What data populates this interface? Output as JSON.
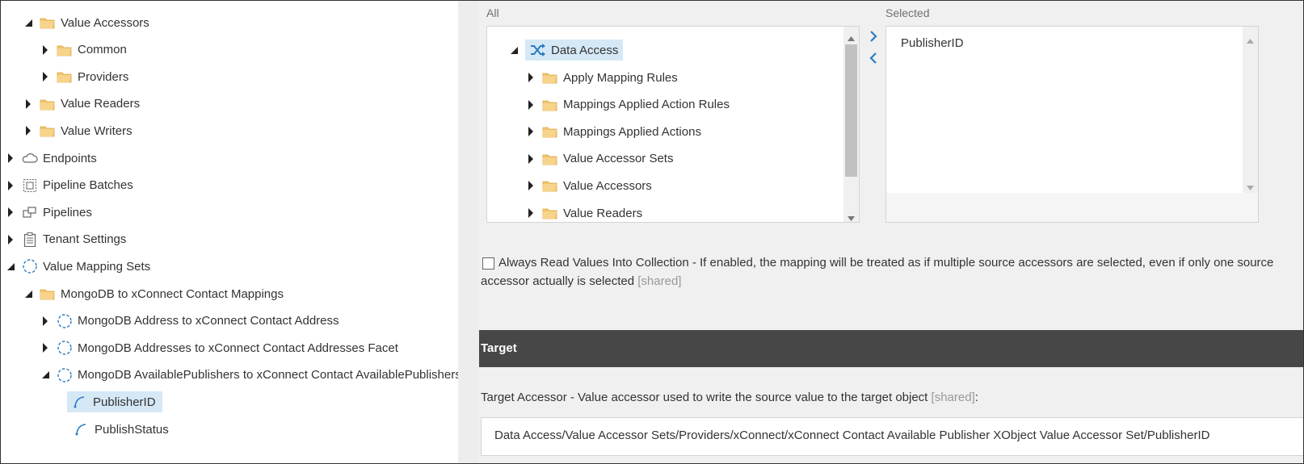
{
  "tree": [
    {
      "label": "Value Accessors",
      "level": 1,
      "expander": "down",
      "icon": "folder-icon"
    },
    {
      "label": "Common",
      "level": 2,
      "expander": "right",
      "icon": "folder-icon"
    },
    {
      "label": "Providers",
      "level": 2,
      "expander": "right",
      "icon": "folder-icon"
    },
    {
      "label": "Value Readers",
      "level": 1,
      "expander": "right",
      "icon": "folder-icon"
    },
    {
      "label": "Value Writers",
      "level": 1,
      "expander": "right",
      "icon": "folder-icon"
    },
    {
      "label": "Endpoints",
      "level": 0,
      "expander": "right",
      "icon": "cloud-icon"
    },
    {
      "label": "Pipeline Batches",
      "level": 0,
      "expander": "right",
      "icon": "batch-icon"
    },
    {
      "label": "Pipelines",
      "level": 0,
      "expander": "right",
      "icon": "pipelines-icon"
    },
    {
      "label": "Tenant Settings",
      "level": 0,
      "expander": "right",
      "icon": "clipboard-icon"
    },
    {
      "label": "Value Mapping Sets",
      "level": 0,
      "expander": "down",
      "icon": "dashed-circle-icon"
    },
    {
      "label": "MongoDB to xConnect Contact Mappings",
      "level": 1,
      "expander": "down",
      "icon": "folder-icon"
    },
    {
      "label": "MongoDB Address to xConnect Contact Address",
      "level": 2,
      "expander": "right",
      "icon": "dashed-circle-icon"
    },
    {
      "label": "MongoDB Addresses to xConnect Contact Addresses Facet",
      "level": 2,
      "expander": "right",
      "icon": "dashed-circle-icon"
    },
    {
      "label": "MongoDB AvailablePublishers to xConnect Contact AvailablePublishers",
      "level": 2,
      "expander": "down",
      "icon": "dashed-circle-icon"
    },
    {
      "label": "PublisherID",
      "level": 3,
      "expander": "none",
      "icon": "mapping-arc-icon",
      "selected": true
    },
    {
      "label": "PublishStatus",
      "level": 3,
      "expander": "none",
      "icon": "mapping-arc-icon"
    }
  ],
  "source_picker": {
    "all_label": "All",
    "selected_label": "Selected",
    "root_label": "Data Access",
    "root_icon": "shuffle-icon",
    "items": [
      "Apply Mapping Rules",
      "Mappings Applied Action Rules",
      "Mappings Applied Actions",
      "Value Accessor Sets",
      "Value Accessors",
      "Value Readers"
    ],
    "selected_items": [
      "PublisherID"
    ]
  },
  "always_read": {
    "text": "Always Read Values Into Collection - If enabled, the mapping will be treated as if multiple source accessors are selected, even if only one source accessor actually is selected",
    "shared": "[shared]",
    "checked": false
  },
  "target_section": {
    "title": "Target"
  },
  "target_accessor": {
    "label": "Target Accessor - Value accessor used to write the source value to the target object",
    "shared": "[shared]",
    "colon": ":",
    "value": "Data Access/Value Accessor Sets/Providers/xConnect/xConnect Contact Available Publisher XObject Value Accessor Set/PublisherID"
  },
  "colors": {
    "section_bg": "#474747",
    "section_accent": "#dc291e",
    "selection": "#d5e8f6",
    "folder": "#f2c46d",
    "blue_icon": "#2b7cc1"
  }
}
